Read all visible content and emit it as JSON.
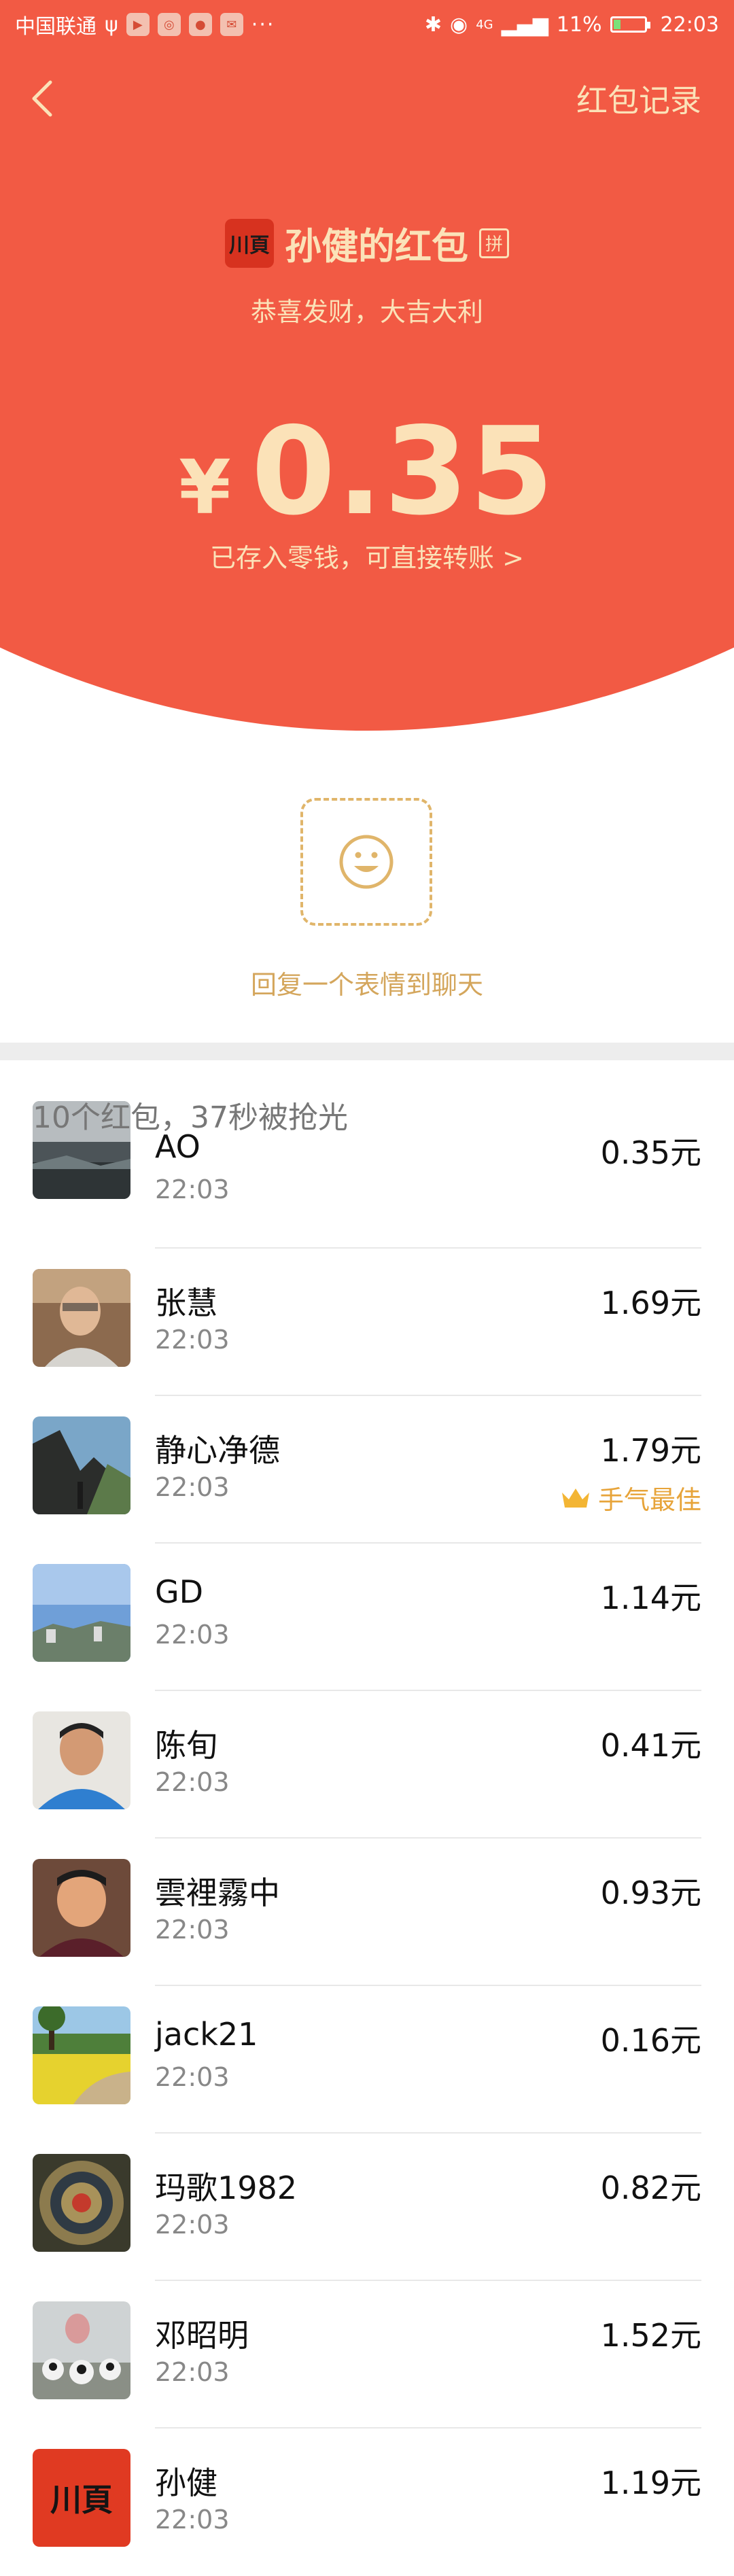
{
  "status_bar": {
    "carrier": "中国联通",
    "extra": "···",
    "network": "4G",
    "battery": "11%",
    "time": "22:03"
  },
  "header": {
    "records_label": "红包记录",
    "sender_name": "孙健的红包",
    "sender_avatar_text": "川頁",
    "pin_label": "拼",
    "greeting": "恭喜发财，大吉大利",
    "currency": "¥",
    "amount": "0.35",
    "stored_note": "已存入零钱，可直接转账 >"
  },
  "reply": {
    "label": "回复一个表情到聊天"
  },
  "summary": "10个红包，37秒被抢光",
  "best_label": "手气最佳",
  "list": [
    {
      "name": "AO",
      "time": "22:03",
      "amount": "0.35元"
    },
    {
      "name": "张慧",
      "time": "22:03",
      "amount": "1.69元"
    },
    {
      "name": "静心净德",
      "time": "22:03",
      "amount": "1.79元"
    },
    {
      "name": "GD",
      "time": "22:03",
      "amount": "1.14元"
    },
    {
      "name": "陈旬",
      "time": "22:03",
      "amount": "0.41元"
    },
    {
      "name": "雲裡霧中",
      "time": "22:03",
      "amount": "0.93元"
    },
    {
      "name": "jack21",
      "time": "22:03",
      "amount": "0.16元"
    },
    {
      "name": "玛歌1982",
      "time": "22:03",
      "amount": "0.82元"
    },
    {
      "name": "邓昭明",
      "time": "22:03",
      "amount": "1.52元"
    },
    {
      "name": "孙健",
      "time": "22:03",
      "amount": "1.19元"
    }
  ],
  "colors": {
    "header_red": "#f25a44",
    "gold_text": "#fbe2b8",
    "best_gold": "#e7a43a"
  }
}
